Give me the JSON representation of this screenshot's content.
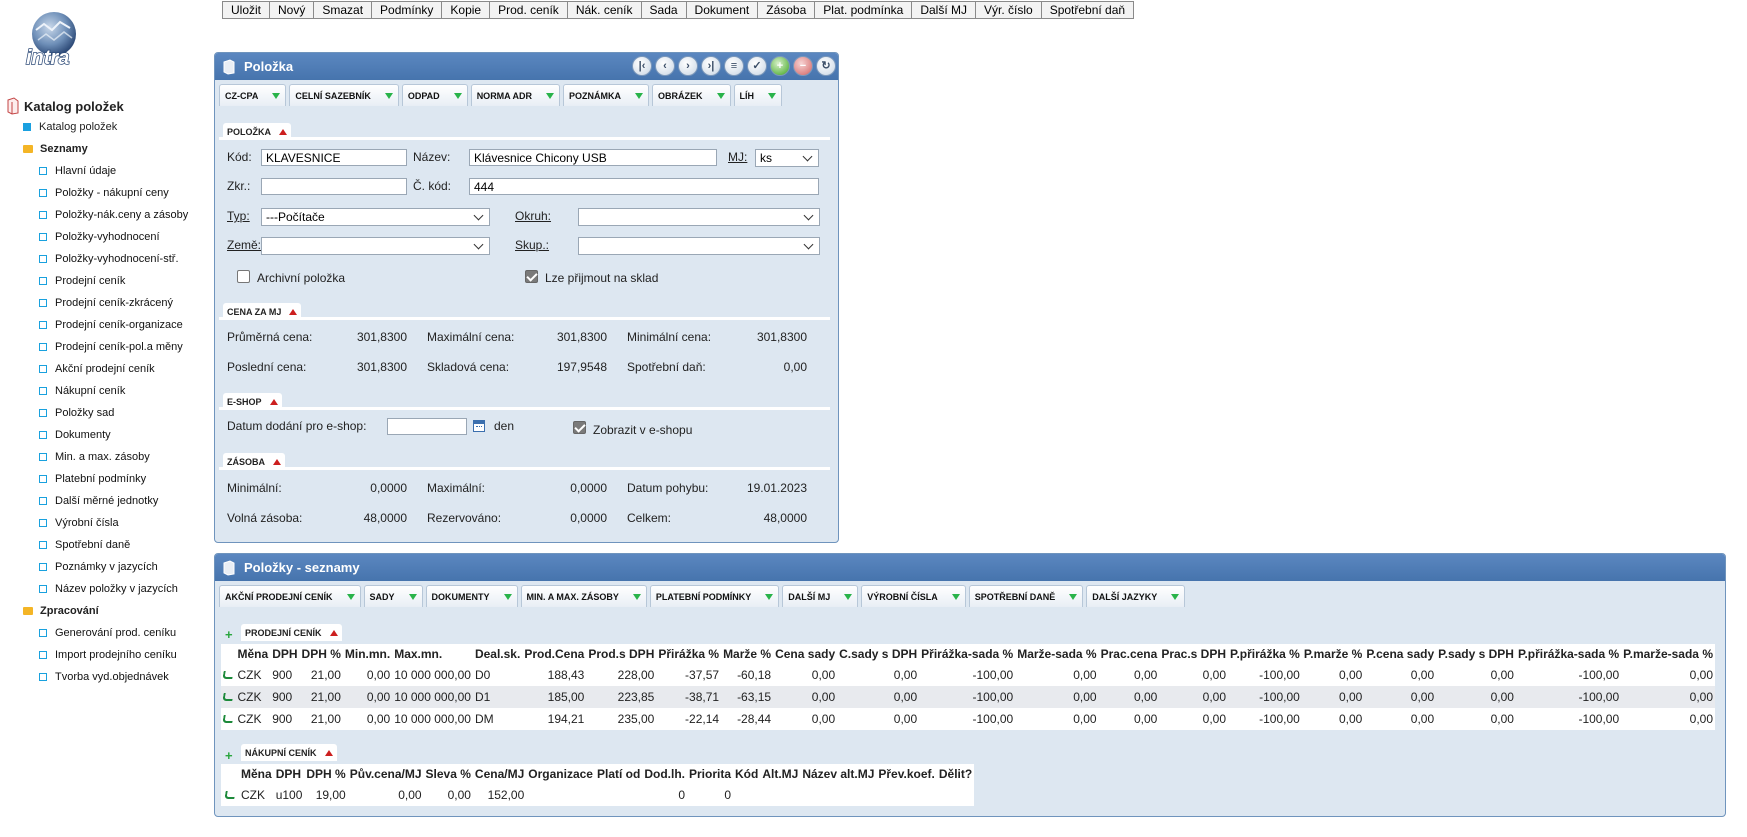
{
  "toolbar": [
    "Uložit",
    "Nový",
    "Smazat",
    "Podmínky",
    "Kopie",
    "Prod. ceník",
    "Nák. ceník",
    "Sada",
    "Dokument",
    "Zásoba",
    "Plat. podmínka",
    "Další MJ",
    "Výr. číslo",
    "Spotřební daň"
  ],
  "logo_text": "intra",
  "sidebar": {
    "root": "Katalog položek",
    "top_item": "Katalog položek",
    "group1": "Seznamy",
    "group1_items": [
      "Hlavní údaje",
      "Položky - nákupní ceny",
      "Položky-nák.ceny a zásoby",
      "Položky-vyhodnocení",
      "Položky-vyhodnocení-stř.",
      "Prodejní ceník",
      "Prodejní ceník-zkrácený",
      "Prodejní ceník-organizace",
      "Prodejní ceník-pol.a měny",
      "Akční prodejní ceník",
      "Nákupní ceník",
      "Položky sad",
      "Dokumenty",
      "Min. a max. zásoby",
      "Platební podmínky",
      "Další měrné jednotky",
      "Výrobní čísla",
      "Spotřební daně",
      "Poznámky v jazycích",
      "Název položky v jazycích"
    ],
    "group2": "Zpracování",
    "group2_items": [
      "Generování prod. ceníku",
      "Import prodejního ceníku",
      "Tvorba vyd.objednávek"
    ]
  },
  "item_panel": {
    "title": "Položka",
    "tabs": [
      "CZ-CPA",
      "CELNÍ SAZEBNÍK",
      "ODPAD",
      "NORMA ADR",
      "POZNÁMKA",
      "OBRÁZEK",
      "LÍH"
    ],
    "polozka": {
      "title": "POLOŽKA",
      "kod_label": "Kód:",
      "kod": "KLAVESNICE",
      "nazev_label": "Název:",
      "nazev": "Klávesnice Chicony USB",
      "mj_label": "MJ:",
      "mj": "ks",
      "zkr_label": "Zkr.:",
      "zkr": "",
      "ckod_label": "Č. kód:",
      "ckod": "444",
      "typ_label": "Typ:",
      "typ": "---Počítače",
      "okruh_label": "Okruh:",
      "okruh": "",
      "zeme_label": "Země:",
      "zeme": "",
      "skup_label": "Skup.:",
      "skup": "",
      "archiv_label": "Archivní položka",
      "sklad_label": "Lze přijmout na sklad"
    },
    "cena": {
      "title": "CENA ZA MJ",
      "prumerna_label": "Průměrná cena:",
      "prumerna": "301,8300",
      "max_label": "Maximální cena:",
      "max": "301,8300",
      "min_label": "Minimální cena:",
      "min": "301,8300",
      "posledni_label": "Poslední cena:",
      "posledni": "301,8300",
      "skladova_label": "Skladová cena:",
      "skladova": "197,9548",
      "spotrebni_label": "Spotřební daň:",
      "spotrebni": "0,00"
    },
    "eshop": {
      "title": "E-SHOP",
      "datum_label": "Datum dodání pro e-shop:",
      "datum": "",
      "den": "den",
      "zobrazit_label": "Zobrazit v e-shopu"
    },
    "zasoba": {
      "title": "ZÁSOBA",
      "min_label": "Minimální:",
      "min": "0,0000",
      "max_label": "Maximální:",
      "max": "0,0000",
      "datum_label": "Datum pohybu:",
      "datum": "19.01.2023",
      "volna_label": "Volná zásoba:",
      "volna": "48,0000",
      "rez_label": "Rezervováno:",
      "rez": "0,0000",
      "celkem_label": "Celkem:",
      "celkem": "48,0000"
    }
  },
  "lists_panel": {
    "title": "Položky - seznamy",
    "tabs": [
      "AKČNÍ PRODEJNÍ CENÍK",
      "SADY",
      "DOKUMENTY",
      "MIN. A MAX. ZÁSOBY",
      "PLATEBNÍ PODMÍNKY",
      "DALŠÍ MJ",
      "VÝROBNÍ ČÍSLA",
      "SPOTŘEBNÍ DANĚ",
      "DALŠÍ JAZYKY"
    ],
    "prodejni": {
      "title": "PRODEJNÍ CENÍK",
      "columns": [
        "Měna",
        "DPH",
        "DPH %",
        "Min.mn.",
        "Max.mn.",
        "Deal.sk.",
        "Prod.Cena",
        "Prod.s DPH",
        "Přirážka %",
        "Marže %",
        "Cena sady",
        "C.sady s DPH",
        "Přirážka-sada %",
        "Marže-sada %",
        "Prac.cena",
        "Prac.s DPH",
        "P.přirážka %",
        "P.marže %",
        "P.cena sady",
        "P.sady s DPH",
        "P.přirážka-sada %",
        "P.marže-sada %"
      ],
      "rows": [
        [
          "CZK",
          "900",
          "21,00",
          "0,00",
          "10 000 000,00",
          "D0",
          "188,43",
          "228,00",
          "-37,57",
          "-60,18",
          "0,00",
          "0,00",
          "-100,00",
          "0,00",
          "0,00",
          "0,00",
          "-100,00",
          "0,00",
          "0,00",
          "0,00",
          "-100,00",
          "0,00"
        ],
        [
          "CZK",
          "900",
          "21,00",
          "0,00",
          "10 000 000,00",
          "D1",
          "185,00",
          "223,85",
          "-38,71",
          "-63,15",
          "0,00",
          "0,00",
          "-100,00",
          "0,00",
          "0,00",
          "0,00",
          "-100,00",
          "0,00",
          "0,00",
          "0,00",
          "-100,00",
          "0,00"
        ],
        [
          "CZK",
          "900",
          "21,00",
          "0,00",
          "10 000 000,00",
          "DM",
          "194,21",
          "235,00",
          "-22,14",
          "-28,44",
          "0,00",
          "0,00",
          "-100,00",
          "0,00",
          "0,00",
          "0,00",
          "-100,00",
          "0,00",
          "0,00",
          "0,00",
          "-100,00",
          "0,00"
        ]
      ]
    },
    "nakupni": {
      "title": "NÁKUPNÍ CENÍK",
      "columns": [
        "Měna",
        "DPH",
        "DPH %",
        "Pův.cena/MJ",
        "Sleva %",
        "Cena/MJ",
        "Organizace",
        "Platí od",
        "Dod.lh.",
        "Priorita",
        "Kód",
        "Alt.MJ",
        "Název alt.MJ",
        "Přev.koef.",
        "Dělit?"
      ],
      "rows": [
        [
          "CZK",
          "u100",
          "19,00",
          "0,00",
          "0,00",
          "152,00",
          "",
          "",
          "0",
          "0",
          "",
          "",
          "",
          "",
          ""
        ]
      ]
    }
  }
}
